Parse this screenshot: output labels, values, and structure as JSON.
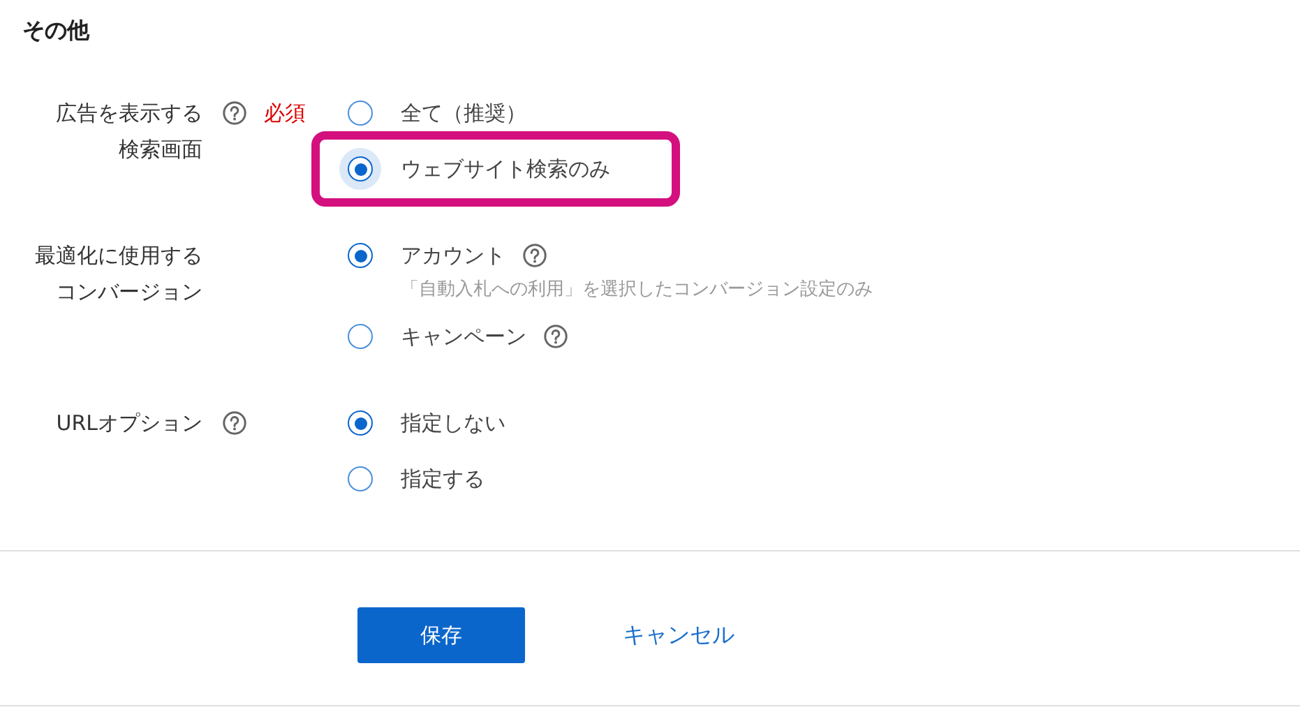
{
  "section_title": "その他",
  "settings": [
    {
      "label_lines": [
        "広告を表示する",
        "検索画面"
      ],
      "help": true,
      "required": "必須",
      "options": [
        {
          "label": "全て（推奨）",
          "selected": false
        },
        {
          "label": "ウェブサイト検索のみ",
          "selected": true,
          "highlighted": true
        }
      ]
    },
    {
      "label_lines": [
        "最適化に使用する",
        "コンバージョン"
      ],
      "options": [
        {
          "label": "アカウント",
          "selected": true,
          "help": true,
          "note": "「自動入札への利用」を選択したコンバージョン設定のみ"
        },
        {
          "label": "キャンペーン",
          "selected": false,
          "help": true
        }
      ]
    },
    {
      "label_lines": [
        "URLオプション"
      ],
      "help": true,
      "options": [
        {
          "label": "指定しない",
          "selected": true
        },
        {
          "label": "指定する",
          "selected": false
        }
      ]
    }
  ],
  "buttons": [
    {
      "kind": "primary",
      "label": "保存"
    },
    {
      "kind": "link",
      "label": "キャンセル"
    }
  ]
}
